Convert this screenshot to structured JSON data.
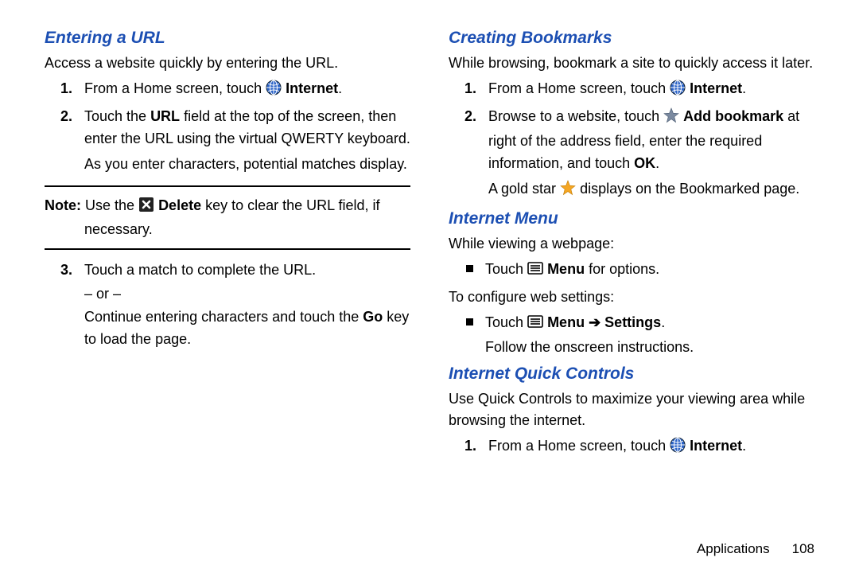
{
  "left": {
    "h1": "Entering a URL",
    "intro": "Access a website quickly by entering the URL.",
    "step1_a": "From a Home screen, touch ",
    "step1_b": "Internet",
    "step1_c": ".",
    "step2_a": "Touch the ",
    "step2_b": "URL",
    "step2_c": " field at the top of the screen, then enter the URL using the virtual QWERTY keyboard.",
    "step2_d": "As you enter characters, potential matches display.",
    "note_lead": "Note:",
    "note_a": " Use the ",
    "note_b": "Delete",
    "note_c": " key to clear the URL field, if",
    "note_d": "necessary.",
    "step3_a": "Touch a match to complete the URL.",
    "step3_or": "– or –",
    "step3_b1": "Continue entering characters and touch the ",
    "step3_b2": "Go",
    "step3_b3": " key to load the page."
  },
  "right": {
    "h1": "Creating Bookmarks",
    "intro": "While browsing, bookmark a site to quickly access it later.",
    "step1_a": "From a Home screen, touch ",
    "step1_b": "Internet",
    "step1_c": ".",
    "step2_a": "Browse to a website, touch ",
    "step2_b": "Add bookmark",
    "step2_c": " at right of the address field, enter the required information, and touch ",
    "step2_d": "OK",
    "step2_e": ".",
    "step2_f1": "A gold star ",
    "step2_f2": " displays on the Bookmarked page.",
    "h2": "Internet Menu",
    "im_a": "While viewing a webpage:",
    "im_b1": "Touch ",
    "im_b2": "Menu",
    "im_b3": " for options.",
    "im_c": "To configure web settings:",
    "im_d1": "Touch ",
    "im_d2": "Menu",
    "im_d3": "Settings",
    "im_d4": ".",
    "im_e": "Follow the onscreen instructions.",
    "h3": "Internet Quick Controls",
    "iqc_intro": "Use Quick Controls to maximize your viewing area while browsing the internet.",
    "iqc1_a": "From a Home screen, touch ",
    "iqc1_b": "Internet",
    "iqc1_c": "."
  },
  "footer": {
    "section": "Applications",
    "page": "108"
  }
}
